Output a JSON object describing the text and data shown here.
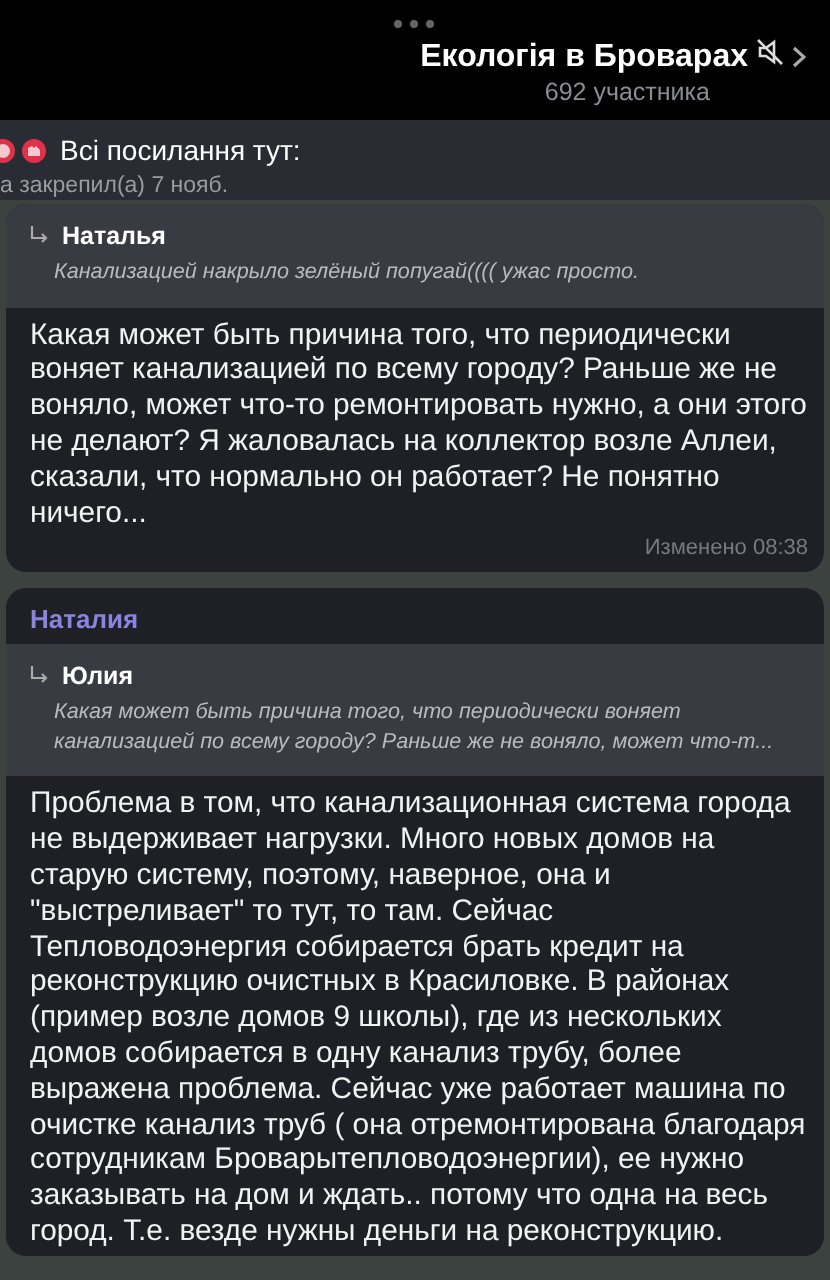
{
  "header": {
    "title": "Екологія в Броварах",
    "members": "692 участника",
    "muted": true
  },
  "pinned": {
    "title": "Всі посилання тут:",
    "subtitle": "а закрепил(а) 7 нояб."
  },
  "messages": [
    {
      "reply": {
        "name": "Наталья",
        "text": "Канализацией накрыло зелёный попугай(((( ужас просто."
      },
      "text": "Какая может быть причина того, что периодически воняет канализацией по всему городу? Раньше же не воняло, может что-то ремонтировать нужно, а они этого не делают? Я жаловалась на коллектор возле Аллеи, сказали, что нормально он работает? Не понятно ничего...",
      "status": "Изменено 08:38"
    },
    {
      "sender": "Наталия",
      "reply": {
        "name": "Юлия",
        "text": "Какая может быть причина того, что периодически воняет канализацией по всему городу? Раньше же не воняло, может что-т..."
      },
      "text": "Проблема в том, что канализационная система города не выдерживает нагрузки. Много новых домов на старую систему, поэтому, наверное, она и \"выстреливает\" то тут, то там. Сейчас Тепловодоэнергия собирается брать кредит на реконструкцию очистных в Красиловке. В районах (пример возле домов 9 школы), где из нескольких домов собирается в одну канализ трубу, более выражена проблема. Сейчас уже работает машина  по очистке канализ труб ( она отремонтирована благодаря сотрудникам Броварытепловодоэнергии), ее нужно заказывать на дом и ждать.. потому что одна на весь город. Т.е. везде нужны деньги на реконструкцию."
    }
  ]
}
